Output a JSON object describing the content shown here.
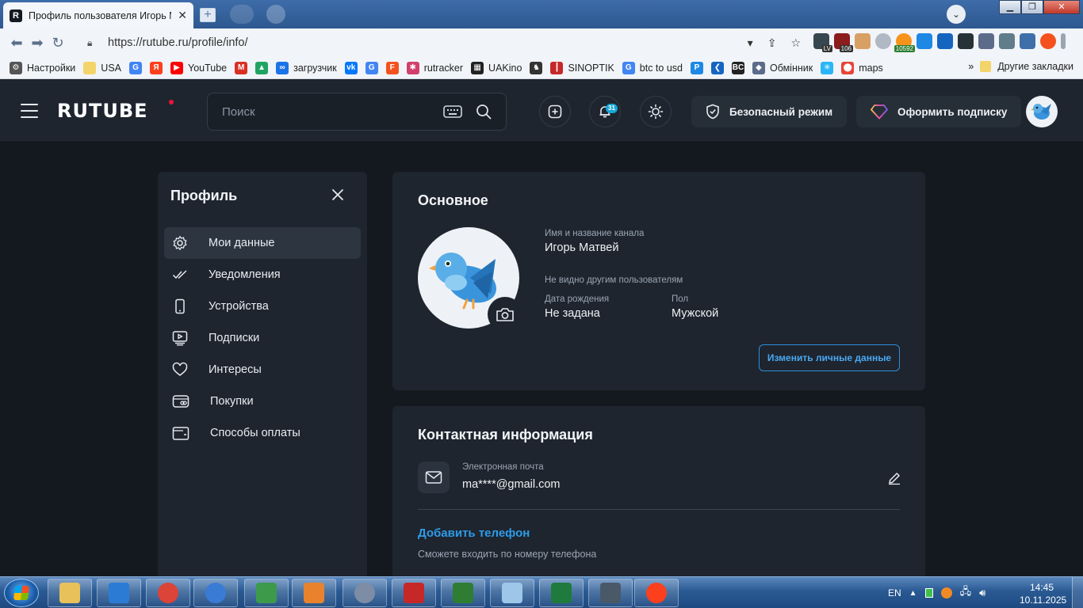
{
  "browser": {
    "tab_title": "Профиль пользователя Игорь Ма",
    "tab_favicon_letter": "R",
    "url": "https://rutube.ru/profile/info/",
    "extension_badges": [
      "LV",
      "106",
      "10592"
    ],
    "bookmarks": [
      {
        "label": "Настройки",
        "icon": "gear-icon",
        "color": "#555555"
      },
      {
        "label": "USA",
        "icon": "folder-icon",
        "color": "#f3d46a"
      },
      {
        "label": "",
        "icon": "google-icon",
        "color": "#4285f4"
      },
      {
        "label": "",
        "icon": "yandex-icon",
        "color": "#fc3f1d"
      },
      {
        "label": "YouTube",
        "icon": "youtube-icon",
        "color": "#ff0000"
      },
      {
        "label": "",
        "icon": "gmail-icon",
        "color": "#d93025"
      },
      {
        "label": "",
        "icon": "drive-icon",
        "color": "#1fa463"
      },
      {
        "label": "загрузчик",
        "icon": "infinity-icon",
        "color": "#1a73e8"
      },
      {
        "label": "",
        "icon": "vk-icon",
        "color": "#0077ff"
      },
      {
        "label": "",
        "icon": "translate-icon",
        "color": "#4285f4"
      },
      {
        "label": "",
        "icon": "f-icon",
        "color": "#f4511e"
      },
      {
        "label": "rutracker",
        "icon": "rutracker-icon",
        "color": "#d23f6b"
      },
      {
        "label": "UAKino",
        "icon": "uakino-icon",
        "color": "#222222"
      },
      {
        "label": "",
        "icon": "chess-icon",
        "color": "#333333"
      },
      {
        "label": "SINOPTIK",
        "icon": "thermometer-icon",
        "color": "#c62828"
      },
      {
        "label": "btc to usd",
        "icon": "google-icon",
        "color": "#4285f4"
      },
      {
        "label": "",
        "icon": "p-icon",
        "color": "#1e88e5"
      },
      {
        "label": "",
        "icon": "arrow-icon",
        "color": "#1565c0"
      },
      {
        "label": "",
        "icon": "bc-icon",
        "color": "#222222"
      },
      {
        "label": "Обмінник",
        "icon": "diamond-icon",
        "color": "#5c6b8a"
      },
      {
        "label": "",
        "icon": "star-icon",
        "color": "#29b6f6"
      },
      {
        "label": "maps",
        "icon": "maps-pin-icon",
        "color": "#ea4335"
      }
    ],
    "more_bookmarks": "»",
    "other_bookmarks": "Другие закладки"
  },
  "rutube": {
    "logo": "RUTUBE",
    "search_placeholder": "Поиск",
    "notifications_count": "31",
    "safe_mode_label": "Безопасный режим",
    "subscribe_label": "Оформить подписку",
    "accent_red": "#ed143b",
    "accent_blue": "#2f9be8"
  },
  "sidebar": {
    "title": "Профиль",
    "items": [
      {
        "label": "Мои данные",
        "icon": "gear-icon",
        "active": true
      },
      {
        "label": "Уведомления",
        "icon": "double-check-icon",
        "active": false
      },
      {
        "label": "Устройства",
        "icon": "phone-icon",
        "active": false
      },
      {
        "label": "Подписки",
        "icon": "subscriptions-icon",
        "active": false
      },
      {
        "label": "Интересы",
        "icon": "heart-icon",
        "active": false
      },
      {
        "label": "Покупки",
        "icon": "ticket-icon",
        "active": false
      },
      {
        "label": "Способы оплаты",
        "icon": "wallet-icon",
        "active": false
      }
    ]
  },
  "main": {
    "title": "Основное",
    "name_label": "Имя и название канала",
    "name_value": "Игорь Матвей",
    "hidden_note": "Не видно другим пользователям",
    "birth_label": "Дата рождения",
    "birth_value": "Не задана",
    "gender_label": "Пол",
    "gender_value": "Мужской",
    "edit_button": "Изменить личные данные"
  },
  "contacts": {
    "title": "Контактная информация",
    "email_label": "Электронная почта",
    "email_value": "ma****@gmail.com",
    "add_phone": "Добавить телефон",
    "phone_hint": "Сможете входить по номеру телефона"
  },
  "taskbar": {
    "lang": "EN",
    "time": "14:45",
    "date": "10.11.2025",
    "apps": [
      {
        "name": "explorer-icon",
        "color": "#e8c15a"
      },
      {
        "name": "wise-icon",
        "color": "#2b7bd4"
      },
      {
        "name": "chrome-icon",
        "color": "#db4437"
      },
      {
        "name": "globe-icon",
        "color": "#3a7bd5"
      },
      {
        "name": "card-icon",
        "color": "#3d9a4b"
      },
      {
        "name": "player-icon",
        "color": "#e9822d"
      },
      {
        "name": "clock-app-icon",
        "color": "#7c8da5"
      },
      {
        "name": "aida64-icon",
        "color": "#c62828"
      },
      {
        "name": "chart-app-icon",
        "color": "#2e7d32"
      },
      {
        "name": "notepad-icon",
        "color": "#9ec6e8"
      },
      {
        "name": "excel-icon",
        "color": "#1f7a3e"
      },
      {
        "name": "monitor-icon",
        "color": "#4a5968"
      },
      {
        "name": "yandex-browser-icon",
        "color": "#fc3f1d"
      }
    ]
  }
}
